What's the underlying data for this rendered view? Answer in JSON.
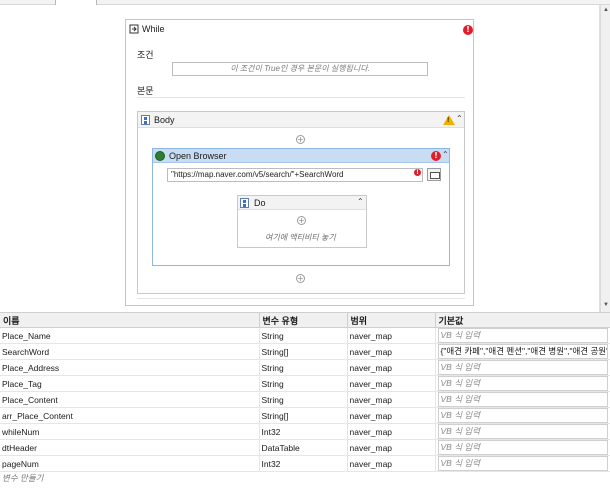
{
  "designer": {
    "while": {
      "title": "While",
      "condition_label": "조건",
      "condition_placeholder": "이 조건이 True인 경우 본문이 실행됩니다.",
      "body_label": "본문",
      "error_mark": "!"
    },
    "body_sequence": {
      "title": "Body",
      "warning_mark": "!"
    },
    "open_browser": {
      "title": "Open Browser",
      "url_value": "\"https://map.naver.com/v5/search/\"+SearchWord",
      "error_mark": "!"
    },
    "do_sequence": {
      "title": "Do",
      "drop_hint": "여기에 액티비티 놓기"
    }
  },
  "variables_panel": {
    "columns": [
      "이름",
      "변수 유형",
      "범위",
      "기본값"
    ],
    "rows": [
      {
        "name": "Place_Name",
        "type": "String",
        "scope": "naver_map",
        "default": "",
        "placeholder": "VB 식 입력"
      },
      {
        "name": "SearchWord",
        "type": "String[]",
        "scope": "naver_map",
        "default": "{\"애견 카페\",\"애견 펜션\",\"애견 병원\",\"애견 공원\"}",
        "placeholder": ""
      },
      {
        "name": "Place_Address",
        "type": "String",
        "scope": "naver_map",
        "default": "",
        "placeholder": "VB 식 입력"
      },
      {
        "name": "Place_Tag",
        "type": "String",
        "scope": "naver_map",
        "default": "",
        "placeholder": "VB 식 입력"
      },
      {
        "name": "Place_Content",
        "type": "String",
        "scope": "naver_map",
        "default": "",
        "placeholder": "VB 식 입력"
      },
      {
        "name": "arr_Place_Content",
        "type": "String[]",
        "scope": "naver_map",
        "default": "",
        "placeholder": "VB 식 입력"
      },
      {
        "name": "whileNum",
        "type": "Int32",
        "scope": "naver_map",
        "default": "",
        "placeholder": "VB 식 입력"
      },
      {
        "name": "dtHeader",
        "type": "DataTable",
        "scope": "naver_map",
        "default": "",
        "placeholder": "VB 식 입력"
      },
      {
        "name": "pageNum",
        "type": "Int32",
        "scope": "naver_map",
        "default": "",
        "placeholder": "VB 식 입력"
      }
    ],
    "create_variable": "변수 만들기"
  },
  "colors": {
    "error": "#e01e2b",
    "warning": "#f2b000",
    "selected_header": "#c8ddf4"
  }
}
